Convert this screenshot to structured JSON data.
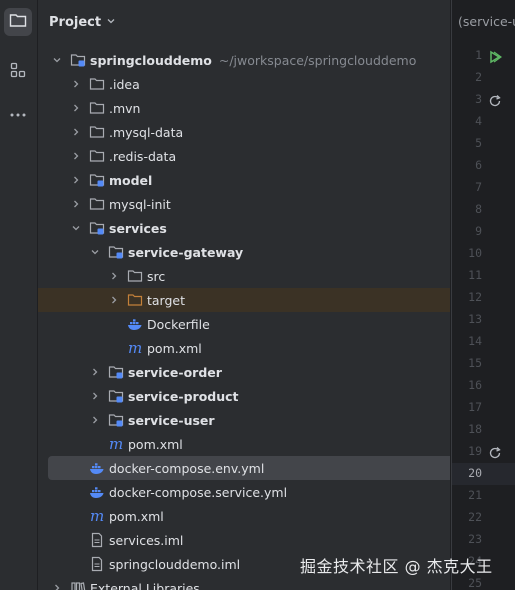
{
  "activity_bar": {
    "items": [
      {
        "name": "project-icon",
        "active": true
      },
      {
        "name": "structure-icon",
        "active": false
      },
      {
        "name": "more-icon",
        "active": false
      }
    ]
  },
  "panel": {
    "title": "Project"
  },
  "tree": [
    {
      "label": "springclouddemo",
      "sub": "~/jworkspace/springclouddemo",
      "chevron": "down",
      "icon": "module-folder-icon",
      "bold": true,
      "depth": 0
    },
    {
      "label": ".idea",
      "chevron": "right",
      "icon": "folder-icon",
      "depth": 1
    },
    {
      "label": ".mvn",
      "chevron": "right",
      "icon": "folder-icon",
      "depth": 1
    },
    {
      "label": ".mysql-data",
      "chevron": "right",
      "icon": "folder-icon",
      "depth": 1
    },
    {
      "label": ".redis-data",
      "chevron": "right",
      "icon": "folder-icon",
      "depth": 1
    },
    {
      "label": "model",
      "chevron": "right",
      "icon": "module-folder-icon",
      "bold": true,
      "depth": 1
    },
    {
      "label": "mysql-init",
      "chevron": "right",
      "icon": "folder-icon",
      "depth": 1
    },
    {
      "label": "services",
      "chevron": "down",
      "icon": "module-folder-icon",
      "bold": true,
      "depth": 1
    },
    {
      "label": "service-gateway",
      "chevron": "down",
      "icon": "module-folder-icon",
      "bold": true,
      "depth": 2
    },
    {
      "label": "src",
      "chevron": "right",
      "icon": "folder-icon",
      "depth": 3
    },
    {
      "label": "target",
      "chevron": "right",
      "icon": "excluded-folder-icon",
      "depth": 3,
      "excluded": true
    },
    {
      "label": "Dockerfile",
      "icon": "docker-icon",
      "depth": 3
    },
    {
      "label": "pom.xml",
      "icon": "maven-icon",
      "depth": 3
    },
    {
      "label": "service-order",
      "chevron": "right",
      "icon": "module-folder-icon",
      "bold": true,
      "depth": 2
    },
    {
      "label": "service-product",
      "chevron": "right",
      "icon": "module-folder-icon",
      "bold": true,
      "depth": 2
    },
    {
      "label": "service-user",
      "chevron": "right",
      "icon": "module-folder-icon",
      "bold": true,
      "depth": 2
    },
    {
      "label": "pom.xml",
      "icon": "maven-icon",
      "depth": 2
    },
    {
      "label": "docker-compose.env.yml",
      "icon": "docker-icon",
      "depth": 1,
      "selected": true
    },
    {
      "label": "docker-compose.service.yml",
      "icon": "docker-icon",
      "depth": 1
    },
    {
      "label": "pom.xml",
      "icon": "maven-icon",
      "depth": 1
    },
    {
      "label": "services.iml",
      "icon": "file-icon",
      "depth": 1
    },
    {
      "label": "springclouddemo.iml",
      "icon": "file-icon",
      "depth": 1
    },
    {
      "label": "External Libraries",
      "chevron": "right",
      "icon": "library-icon",
      "depth": 0
    }
  ],
  "editor": {
    "tab_title": "(service-u",
    "line_numbers": [
      "1",
      "2",
      "3",
      "4",
      "5",
      "6",
      "7",
      "8",
      "9",
      "10",
      "11",
      "12",
      "13",
      "14",
      "15",
      "16",
      "17",
      "18",
      "19",
      "20",
      "21",
      "22",
      "23",
      "24",
      "25"
    ],
    "current_line": "20",
    "gutter_icons": [
      {
        "line": "1",
        "name": "run-icon"
      },
      {
        "line": "3",
        "name": "refresh-icon"
      },
      {
        "line": "19",
        "name": "refresh-icon"
      }
    ]
  },
  "watermark": "掘金技术社区 @ 杰克大王",
  "colors": {
    "panel_bg": "#2b2d30",
    "editor_bg": "#1e1f22",
    "selection": "#43454a",
    "excluded_bg": "#3b3225",
    "folder_icon": "#a9acb2",
    "module_blue": "#548af7",
    "excluded_orange": "#c4813a",
    "run_green": "#5fb865"
  }
}
